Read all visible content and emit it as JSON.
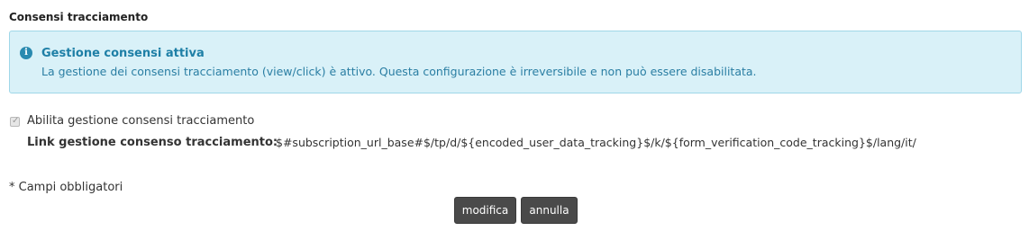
{
  "section": {
    "title": "Consensi tracciamento"
  },
  "info": {
    "icon": "info-circle-icon",
    "title": "Gestione consensi attiva",
    "message": "La gestione dei consensi tracciamento (view/click) è attivo. Questa configurazione è irreversibile e non può essere disabilitata.",
    "colors": {
      "background": "#d9f1f8",
      "border": "#9fd7e8",
      "text": "#2a7ea3"
    }
  },
  "form": {
    "checkbox_label": "Abilita gestione consensi tracciamento",
    "checkbox_checked": true,
    "checkbox_disabled": true,
    "link_label": "Link gestione consenso tracciamento:",
    "link_value": "$#subscription_url_base#$/tp/d/${encoded_user_data_tracking}$/k/${form_verification_code_tracking}$/lang/it/",
    "required_note": "* Campi obbligatori"
  },
  "actions": {
    "edit_label": "modifica",
    "cancel_label": "annulla"
  }
}
